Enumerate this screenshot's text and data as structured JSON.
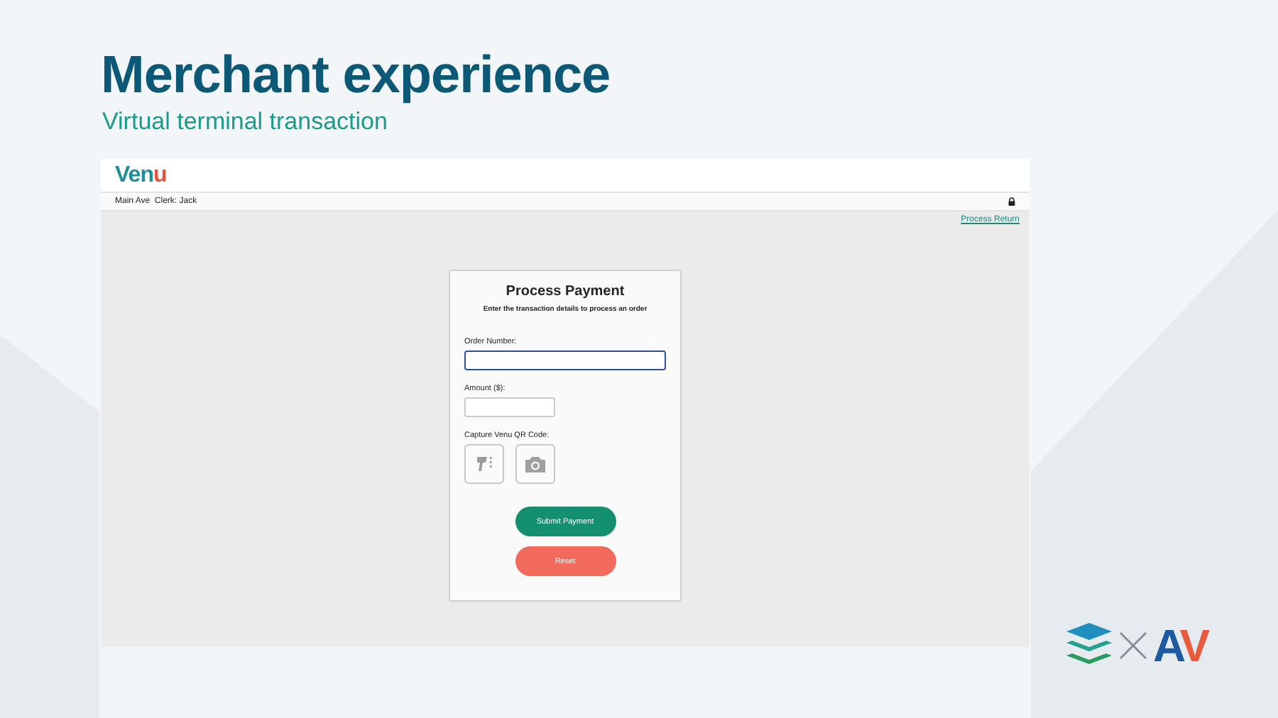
{
  "slide": {
    "title": "Merchant experience",
    "subtitle": "Virtual terminal transaction"
  },
  "app": {
    "logo": [
      {
        "text": "Ven",
        "color": "#1f8f9a"
      },
      {
        "text": "u",
        "color": "#e5533d"
      }
    ],
    "location": "Main Ave",
    "clerk": "Clerk: Jack",
    "process_return": "Process Return",
    "form": {
      "title": "Process Payment",
      "subtitle": "Enter the transaction details to process an order",
      "fields": [
        {
          "label": "Order Number:",
          "focused": true
        },
        {
          "label": "Amount ($):",
          "focused": false
        }
      ],
      "capture_label": "Capture Venu QR Code:",
      "buttons": [
        {
          "label": "Submit Payment",
          "kind": "primary"
        },
        {
          "label": "Reset",
          "kind": "danger"
        }
      ]
    }
  },
  "partner_logo": {
    "text": [
      {
        "text": "A",
        "color": "#1e5aa0"
      },
      {
        "text": "V",
        "color": "#e85a3c"
      }
    ]
  }
}
